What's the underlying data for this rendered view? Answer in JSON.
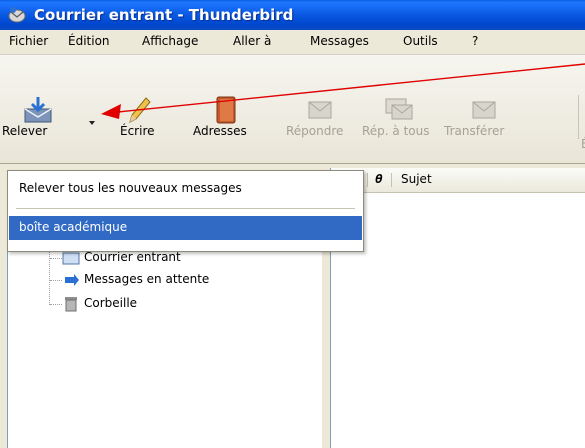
{
  "window": {
    "title": "Courrier entrant - Thunderbird"
  },
  "menu": [
    {
      "label": "Fichier"
    },
    {
      "label": "Édition"
    },
    {
      "label": "Affichage"
    },
    {
      "label": "Aller à"
    },
    {
      "label": "Messages"
    },
    {
      "label": "Outils"
    },
    {
      "label": "?"
    }
  ],
  "toolbar": {
    "buttons": [
      {
        "label": "Relever",
        "enabled": true
      },
      {
        "label": "Écrire",
        "enabled": true
      },
      {
        "label": "Adresses",
        "enabled": true
      },
      {
        "label": "Répondre",
        "enabled": false
      },
      {
        "label": "Rép. à tous",
        "enabled": false
      },
      {
        "label": "Transférer",
        "enabled": false
      },
      {
        "label": "É",
        "enabled": false
      }
    ]
  },
  "dropdown": {
    "items": [
      {
        "label": "Relever tous les nouveaux messages"
      },
      {
        "label": "boîte académique",
        "selected": true
      }
    ]
  },
  "folders": [
    {
      "label": "Courrier entrant"
    },
    {
      "label": "Messages en attente"
    },
    {
      "label": "Corbeille"
    }
  ],
  "message_list": {
    "columns": [
      {
        "label": "Sujet"
      }
    ]
  },
  "colors": {
    "selection": "#316ac5",
    "annotation_arrow": "#e00000",
    "titlebar": "#0a56dc"
  }
}
